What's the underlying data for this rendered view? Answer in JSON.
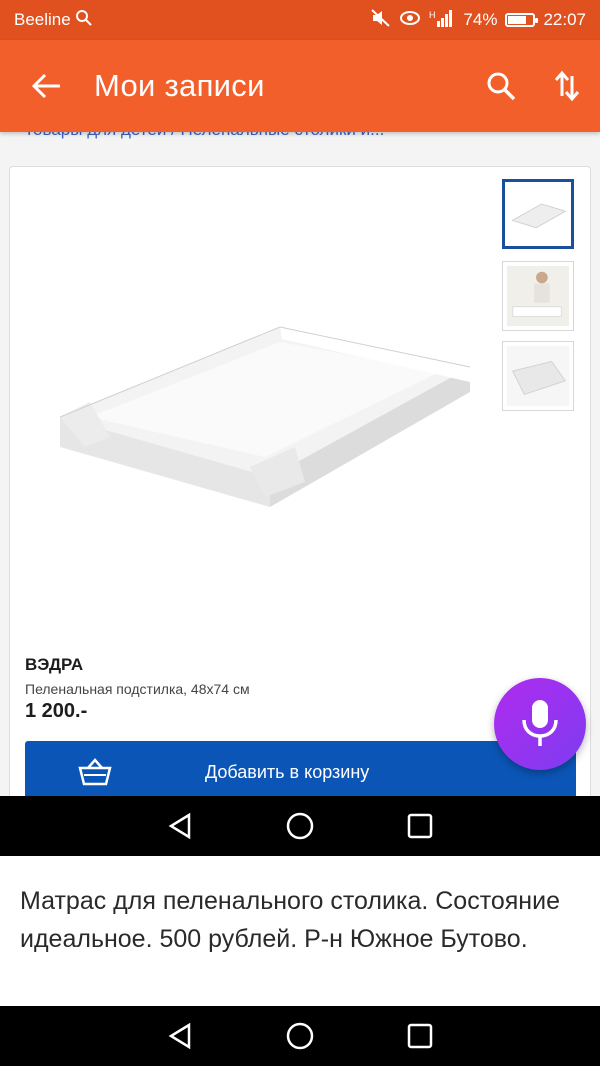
{
  "status_bar": {
    "carrier": "Beeline",
    "signal_text": "H",
    "battery_percent": "74%",
    "battery_level": 0.74,
    "time": "22:07"
  },
  "app_bar": {
    "title": "Мои записи",
    "back_icon": "arrow-left-icon",
    "search_icon": "search-icon",
    "sort_icon": "sort-arrows-icon"
  },
  "page": {
    "breadcrumb": "Товары для детей / Пеленальные столики и...",
    "product": {
      "brand": "ВЭДРА",
      "description": "Пеленальная подстилка, 48x74 см",
      "price": "1 200.-",
      "add_to_cart_label": "Добавить в корзину"
    },
    "thumbnails_count": 3,
    "accent": "#0b55b7"
  },
  "caption": {
    "text": "Матрас для пеленального столика. Состояние идеальное. 500 рублей. Р-н Южное Бутово."
  },
  "colors": {
    "status_bar": "#e0511f",
    "app_bar": "#f35f2a",
    "mic_button": "#9b32f0"
  }
}
